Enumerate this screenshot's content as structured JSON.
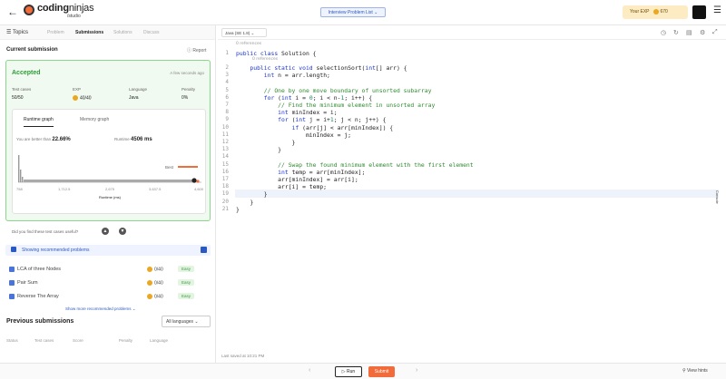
{
  "header": {
    "back_glyph": "←",
    "logo_main": "coding",
    "logo_ninjas": "ninjas",
    "logo_sub": "/studio",
    "problem_list": "Interview Problem List ⌄",
    "exp_label": "Your EXP",
    "exp_value": "670"
  },
  "left_tabs": {
    "topics": "☰ Topics",
    "problem": "Problem",
    "submissions": "Submissions",
    "solutions": "Solutions",
    "discuss": "Discuss"
  },
  "current_submission": {
    "heading": "Current submission",
    "report": "ⓘ Report",
    "status": "Accepted",
    "time": "A few seconds ago",
    "stats": [
      {
        "label": "Test cases",
        "value": "50/50"
      },
      {
        "label": "EXP",
        "value": "40/40"
      },
      {
        "label": "Language",
        "value": "Java"
      },
      {
        "label": "Penalty",
        "value": "0%"
      }
    ],
    "graph_tabs": [
      "Runtime graph",
      "Memory graph"
    ],
    "better_label": "You are better than",
    "better_value": "22.66%",
    "runtime_label": "Runtime",
    "runtime_value": "4506 ms",
    "best_label": "Best",
    "x_ticks": [
      "758",
      "1,712.5",
      "2,675",
      "3,637.5",
      "4,600"
    ],
    "x_axis_label": "Runtime (ms)",
    "useful_q": "Did you find these test cases useful?"
  },
  "recommended": {
    "toggle_label": "Showing recommended problems",
    "items": [
      {
        "name": "LCA of three Nodes",
        "points": "0/40",
        "difficulty": "Easy"
      },
      {
        "name": "Pair Sum",
        "points": "0/40",
        "difficulty": "Easy"
      },
      {
        "name": "Reverse The Array",
        "points": "0/40",
        "difficulty": "Easy"
      }
    ],
    "show_more": "Show more recommended problems ⌄"
  },
  "previous": {
    "heading": "Previous submissions",
    "filter": "All languages ⌄",
    "columns": [
      "Status",
      "Test cases",
      "Score",
      "Penalty",
      "Language"
    ]
  },
  "editor": {
    "language": "Java (SE 1.8) ⌄",
    "refs_label": "0 references",
    "line_numbers": [
      "1",
      "2",
      "3",
      "4",
      "5",
      "6",
      "7",
      "8",
      "9",
      "10",
      "11",
      "12",
      "13",
      "14",
      "15",
      "16",
      "17",
      "18",
      "19",
      "20",
      "21"
    ],
    "saved": "Last saved at 10:21 PM"
  },
  "bottom": {
    "run": "▷ Run",
    "submit": "Submit",
    "prev": "‹",
    "next": "›",
    "hints": "⚲ View hints",
    "console": "Console"
  }
}
